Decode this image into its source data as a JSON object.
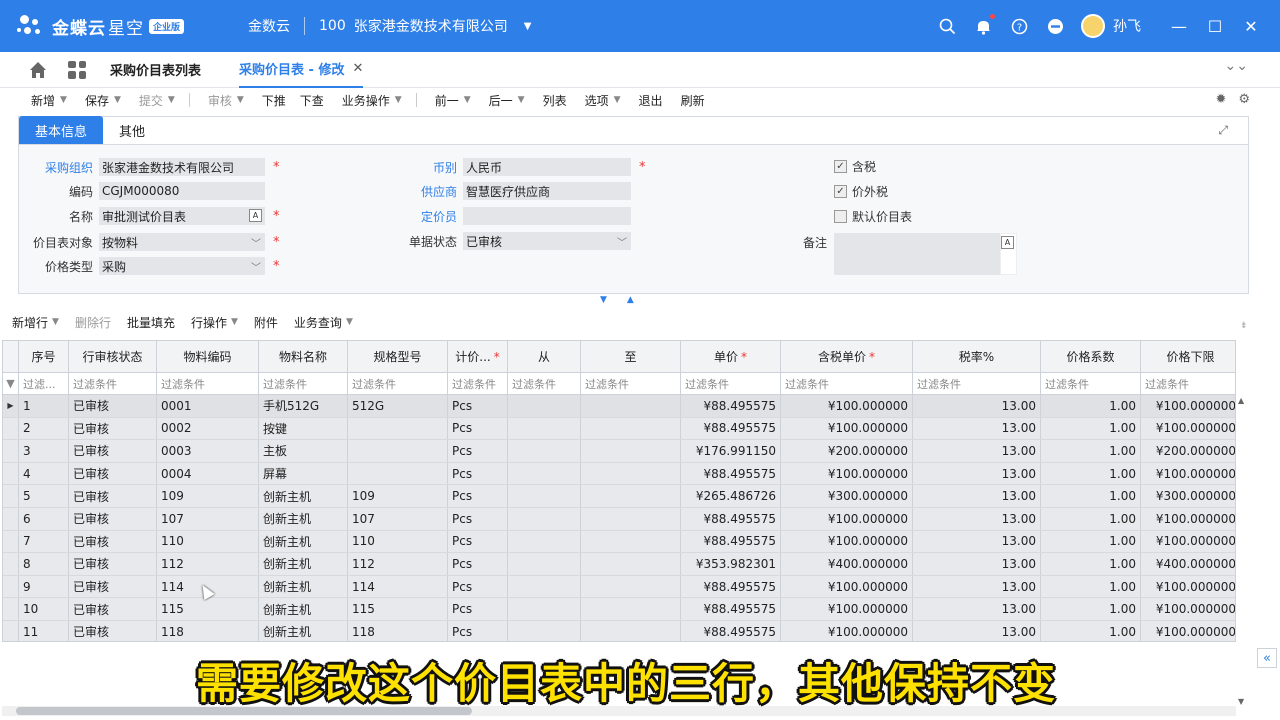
{
  "topbar": {
    "brand": "金蝶云",
    "brand2": "星空",
    "badge": "企业版",
    "app": "金数云",
    "org_code": "100",
    "org_name": "张家港金数技术有限公司",
    "user": "孙飞",
    "accent": "#2e7fe8"
  },
  "tabs": {
    "list_tab": "采购价目表列表",
    "active_tab": "采购价目表 - 修改"
  },
  "toolbar": {
    "new": "新增",
    "save": "保存",
    "submit": "提交",
    "audit": "审核",
    "push": "下推",
    "pull": "下查",
    "business": "业务操作",
    "prev": "前一",
    "next": "后一",
    "list": "列表",
    "options": "选项",
    "exit": "退出",
    "refresh": "刷新"
  },
  "panel": {
    "tab_basic": "基本信息",
    "tab_other": "其他",
    "fields": {
      "org_label": "采购组织",
      "org_value": "张家港金数技术有限公司",
      "code_label": "编码",
      "code_value": "CGJM000080",
      "name_label": "名称",
      "name_value": "审批测试价目表",
      "target_label": "价目表对象",
      "target_value": "按物料",
      "ptype_label": "价格类型",
      "ptype_value": "采购",
      "currency_label": "币别",
      "currency_value": "人民币",
      "supplier_label": "供应商",
      "supplier_value": "智慧医疗供应商",
      "pricer_label": "定价员",
      "pricer_value": "",
      "status_label": "单据状态",
      "status_value": "已审核",
      "remark_label": "备注",
      "tax_label": "含税",
      "tax_checked": true,
      "extra_tax_label": "价外税",
      "extra_tax_checked": true,
      "default_label": "默认价目表",
      "default_checked": false
    }
  },
  "entrybar": {
    "add_row": "新增行",
    "del_row": "删除行",
    "batch": "批量填充",
    "row_ops": "行操作",
    "attach": "附件",
    "query": "业务查询"
  },
  "table": {
    "headers": [
      "序号",
      "行审核状态",
      "物料编码",
      "物料名称",
      "规格型号",
      "计价...",
      "从",
      "至",
      "单价",
      "含税单价",
      "税率%",
      "价格系数",
      "价格下限"
    ],
    "filter_first": "过滤...",
    "filter": "过滤条件",
    "rows": [
      [
        "1",
        "已审核",
        "0001",
        "手机512G",
        " 512G",
        "Pcs",
        "",
        "",
        "¥88.495575",
        "¥100.000000",
        "13.00",
        "1.00",
        "¥100.000000"
      ],
      [
        "2",
        "已审核",
        "0002",
        "按键",
        "",
        "Pcs",
        "",
        "",
        "¥88.495575",
        "¥100.000000",
        "13.00",
        "1.00",
        "¥100.000000"
      ],
      [
        "3",
        "已审核",
        "0003",
        "主板",
        "",
        "Pcs",
        "",
        "",
        "¥176.991150",
        "¥200.000000",
        "13.00",
        "1.00",
        "¥200.000000"
      ],
      [
        "4",
        "已审核",
        "0004",
        "屏幕",
        "",
        "Pcs",
        "",
        "",
        "¥88.495575",
        "¥100.000000",
        "13.00",
        "1.00",
        "¥100.000000"
      ],
      [
        "5",
        "已审核",
        "109",
        "创新主机",
        "109",
        "Pcs",
        "",
        "",
        "¥265.486726",
        "¥300.000000",
        "13.00",
        "1.00",
        "¥300.000000"
      ],
      [
        "6",
        "已审核",
        "107",
        "创新主机",
        "107",
        "Pcs",
        "",
        "",
        "¥88.495575",
        "¥100.000000",
        "13.00",
        "1.00",
        "¥100.000000"
      ],
      [
        "7",
        "已审核",
        "110",
        "创新主机",
        "110",
        "Pcs",
        "",
        "",
        "¥88.495575",
        "¥100.000000",
        "13.00",
        "1.00",
        "¥100.000000"
      ],
      [
        "8",
        "已审核",
        "112",
        "创新主机",
        "112",
        "Pcs",
        "",
        "",
        "¥353.982301",
        "¥400.000000",
        "13.00",
        "1.00",
        "¥400.000000"
      ],
      [
        "9",
        "已审核",
        "114",
        "创新主机",
        "114",
        "Pcs",
        "",
        "",
        "¥88.495575",
        "¥100.000000",
        "13.00",
        "1.00",
        "¥100.000000"
      ],
      [
        "10",
        "已审核",
        "115",
        "创新主机",
        "115",
        "Pcs",
        "",
        "",
        "¥88.495575",
        "¥100.000000",
        "13.00",
        "1.00",
        "¥100.000000"
      ],
      [
        "11",
        "已审核",
        "118",
        "创新主机",
        "118",
        "Pcs",
        "",
        "",
        "¥88.495575",
        "¥100.000000",
        "13.00",
        "1.00",
        "¥100.000000"
      ]
    ]
  },
  "caption": "需要修改这个价目表中的三行，其他保持不变"
}
